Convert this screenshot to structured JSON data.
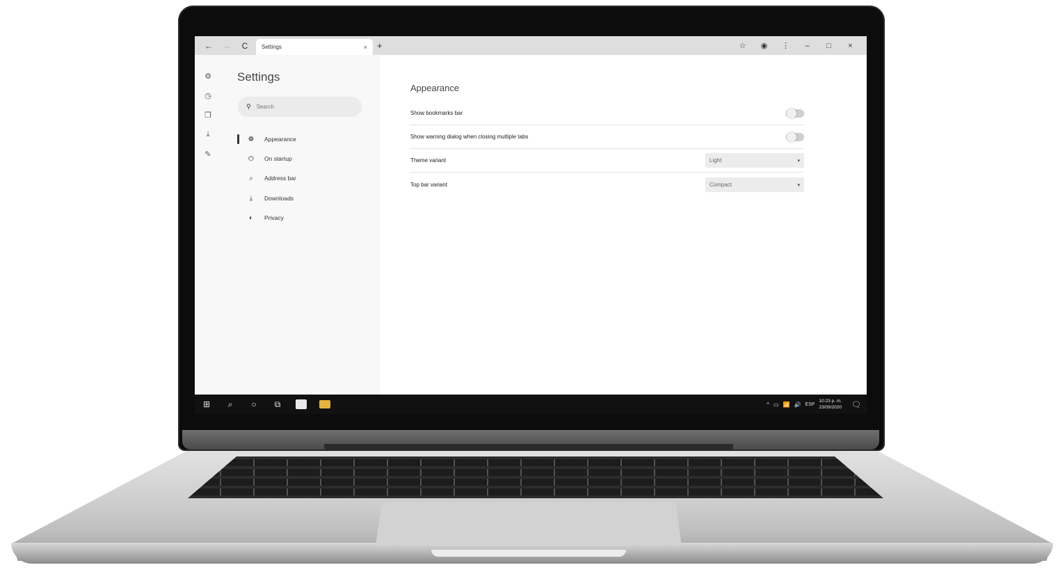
{
  "browser": {
    "tab_title": "Settings",
    "tab_close": "×",
    "new_tab": "+",
    "back": "←",
    "forward": "→",
    "reload": "C",
    "star": "☆",
    "profile": "◉",
    "menu": "⋮",
    "minimize": "–",
    "maximize": "□",
    "close": "×"
  },
  "rail": {
    "icons": [
      "gear-icon",
      "history-icon",
      "copy-icon",
      "download-icon",
      "chat-icon"
    ],
    "glyphs": [
      "⚙",
      "◷",
      "❐",
      "⤓",
      "✎"
    ]
  },
  "sidebar": {
    "title": "Settings",
    "search_placeholder": "Search",
    "search_glyph": "🔍",
    "items": [
      {
        "label": "Appearance",
        "glyph": "❁",
        "active": true
      },
      {
        "label": "On startup",
        "glyph": "⏻",
        "active": false
      },
      {
        "label": "Address bar",
        "glyph": "⌕",
        "active": false
      },
      {
        "label": "Downloads",
        "glyph": "⤓",
        "active": false
      },
      {
        "label": "Privacy",
        "glyph": "◐",
        "active": false
      }
    ]
  },
  "content": {
    "section_title": "Appearance",
    "rows": [
      {
        "label": "Show bookmarks bar",
        "control": "toggle",
        "on": false
      },
      {
        "label": "Show warning dialog when closing multiple tabs",
        "control": "toggle",
        "on": false
      },
      {
        "label": "Theme variant",
        "control": "select",
        "value": "Light"
      },
      {
        "label": "Top bar variant",
        "control": "select",
        "value": "Compact"
      }
    ],
    "select_arrow": "▾"
  },
  "taskbar": {
    "start": "⊞",
    "search": "⌕",
    "cortana": "○",
    "taskview": "⧉",
    "tray_glyphs": [
      "^",
      "▭",
      "📶",
      "🔊"
    ],
    "language": "ESP",
    "time": "10:23 p. m.",
    "date": "23/09/2020",
    "notification": "🗨"
  },
  "colors": {
    "screen_bg": "#ffffff",
    "sidebar_bg": "#f8f8f8",
    "topbar_bg": "#dedede",
    "taskbar_bg": "#111111",
    "laptop_bezel": "#0c0c0c"
  }
}
